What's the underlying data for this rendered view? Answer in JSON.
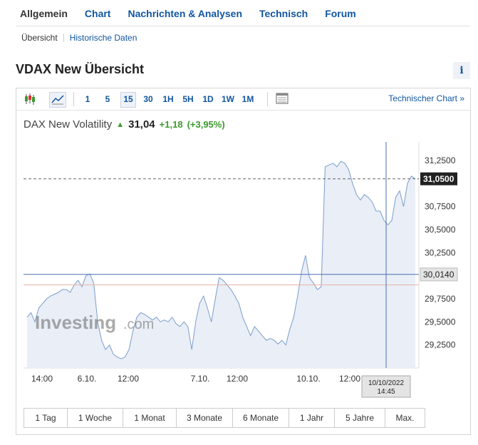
{
  "tabs": [
    "Allgemein",
    "Chart",
    "Nachrichten & Analysen",
    "Technisch",
    "Forum"
  ],
  "subtabs": [
    "Übersicht",
    "Historische Daten"
  ],
  "title": "VDAX New Übersicht",
  "info_label": "i",
  "toolbar": {
    "intervals": [
      "1",
      "5",
      "15",
      "30",
      "1H",
      "5H",
      "1D",
      "1W",
      "1M"
    ],
    "active_interval": "15",
    "tech_link": "Technischer Chart »"
  },
  "quote": {
    "name": "DAX New Volatility",
    "arrow": "▲",
    "price": "31,04",
    "change": "+1,18",
    "change_pct": "(+3,95%)"
  },
  "chart_data": {
    "type": "line",
    "x": [
      "14:00",
      "6.10.",
      "12:00",
      "7.10.",
      "12:00",
      "10.10.",
      "12:00"
    ],
    "y_ticks": [
      "31,2500",
      "30,7500",
      "30,5000",
      "30,2500",
      "29,7500",
      "29,5000",
      "29,2500"
    ],
    "ylim": [
      29.0,
      31.45
    ],
    "values": [
      29.55,
      29.6,
      29.5,
      29.65,
      29.7,
      29.75,
      29.78,
      29.8,
      29.82,
      29.85,
      29.85,
      29.82,
      29.9,
      29.95,
      29.88,
      30.0,
      30.02,
      29.92,
      29.5,
      29.3,
      29.2,
      29.25,
      29.15,
      29.12,
      29.1,
      29.12,
      29.2,
      29.4,
      29.55,
      29.6,
      29.58,
      29.55,
      29.52,
      29.55,
      29.5,
      29.52,
      29.5,
      29.55,
      29.48,
      29.45,
      29.5,
      29.45,
      29.2,
      29.5,
      29.7,
      29.78,
      29.65,
      29.5,
      29.75,
      29.98,
      29.95,
      29.9,
      29.85,
      29.78,
      29.7,
      29.55,
      29.45,
      29.35,
      29.45,
      29.4,
      29.35,
      29.3,
      29.32,
      29.3,
      29.26,
      29.3,
      29.25,
      29.42,
      29.55,
      29.78,
      30.05,
      30.22,
      29.98,
      29.92,
      29.85,
      29.88,
      31.18,
      31.2,
      31.22,
      31.18,
      31.24,
      31.22,
      31.15,
      31.0,
      30.88,
      30.82,
      30.88,
      30.85,
      30.8,
      30.7,
      30.7,
      30.6,
      30.55,
      30.6,
      30.85,
      30.92,
      30.75,
      31.0,
      31.08,
      31.05
    ],
    "last_value": "31,0500",
    "crosshair_value": "30,0140",
    "crosshair_time": [
      "10/10/2022",
      "14:45"
    ]
  },
  "ranges": [
    "1 Tag",
    "1 Woche",
    "1 Monat",
    "3 Monate",
    "6 Monate",
    "1 Jahr",
    "5 Jahre",
    "Max."
  ],
  "watermark": {
    "brand": "Investing",
    "suffix": ".com"
  },
  "colors": {
    "link": "#1256a0",
    "positive": "#3a9b2b",
    "line": "#7c9ccb",
    "fill": "#e9eef7"
  }
}
